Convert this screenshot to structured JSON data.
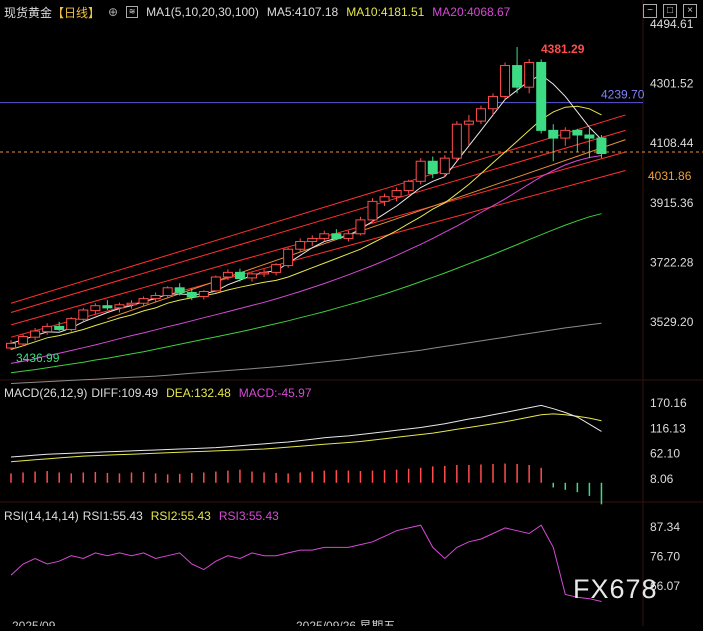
{
  "header": {
    "instrument": "现货黄金",
    "period": "【日线】",
    "ma_label": "MA1(5,10,20,30,100)",
    "ma5": "MA5:4107.18",
    "ma10": "MA10:4181.51",
    "ma20": "MA20:4068.67"
  },
  "macd_header": {
    "label": "MACD(26,12,9)",
    "diff": "DIFF:109.49",
    "dea": "DEA:132.48",
    "macd": "MACD:-45.97"
  },
  "rsi_header": {
    "label": "RSI(14,14,14)",
    "rsi1": "RSI1:55.43",
    "rsi2": "RSI2:55.43",
    "rsi3": "RSI3:55.43"
  },
  "price_axis": [
    "4494.61",
    "4301.52",
    "4108.44",
    "3915.36",
    "3722.28",
    "3529.20"
  ],
  "price_markers": {
    "high": "4381.29",
    "low": "3436.99",
    "h_line": "4239.70",
    "last": "4031.86"
  },
  "macd_axis": [
    "170.16",
    "116.13",
    "62.10",
    "8.06"
  ],
  "rsi_axis": [
    "87.34",
    "76.70",
    "66.07"
  ],
  "date_labels": [
    "2025/09",
    "2025/09/26 星期五"
  ],
  "watermark": "FX678",
  "colors": {
    "up": "#ff4d4d",
    "down": "#3ddc84",
    "ma5": "#e8e8e8",
    "ma10": "#e6e64d",
    "ma20": "#d64ad6",
    "ma30": "#3fcf3f",
    "ma100": "#8c8c8c",
    "dea": "#e6e64d",
    "rsi": "#d64ad6"
  },
  "chart_data": [
    {
      "type": "candlestick",
      "title": "现货黄金 【日线】",
      "ylim": [
        3420,
        4500
      ],
      "candles": [
        [
          3445,
          3470,
          3438,
          3460
        ],
        [
          3458,
          3490,
          3450,
          3482
        ],
        [
          3480,
          3510,
          3470,
          3500
        ],
        [
          3498,
          3525,
          3488,
          3515
        ],
        [
          3515,
          3530,
          3500,
          3505
        ],
        [
          3505,
          3545,
          3498,
          3540
        ],
        [
          3538,
          3575,
          3530,
          3568
        ],
        [
          3566,
          3590,
          3555,
          3582
        ],
        [
          3582,
          3600,
          3568,
          3575
        ],
        [
          3575,
          3592,
          3560,
          3585
        ],
        [
          3585,
          3600,
          3572,
          3590
        ],
        [
          3590,
          3612,
          3580,
          3605
        ],
        [
          3605,
          3625,
          3595,
          3615
        ],
        [
          3615,
          3645,
          3605,
          3640
        ],
        [
          3640,
          3655,
          3615,
          3625
        ],
        [
          3625,
          3638,
          3600,
          3610
        ],
        [
          3612,
          3632,
          3602,
          3628
        ],
        [
          3630,
          3680,
          3625,
          3675
        ],
        [
          3675,
          3700,
          3665,
          3690
        ],
        [
          3690,
          3702,
          3660,
          3670
        ],
        [
          3672,
          3690,
          3660,
          3685
        ],
        [
          3685,
          3700,
          3675,
          3690
        ],
        [
          3690,
          3720,
          3680,
          3715
        ],
        [
          3712,
          3770,
          3705,
          3765
        ],
        [
          3765,
          3800,
          3755,
          3790
        ],
        [
          3790,
          3810,
          3775,
          3800
        ],
        [
          3800,
          3825,
          3790,
          3815
        ],
        [
          3815,
          3830,
          3795,
          3800
        ],
        [
          3800,
          3825,
          3790,
          3815
        ],
        [
          3815,
          3870,
          3810,
          3860
        ],
        [
          3860,
          3930,
          3850,
          3920
        ],
        [
          3920,
          3945,
          3905,
          3935
        ],
        [
          3935,
          3965,
          3920,
          3955
        ],
        [
          3955,
          3990,
          3945,
          3985
        ],
        [
          3985,
          4060,
          3975,
          4050
        ],
        [
          4050,
          4065,
          3995,
          4010
        ],
        [
          4010,
          4070,
          4000,
          4060
        ],
        [
          4060,
          4180,
          4050,
          4170
        ],
        [
          4170,
          4200,
          4100,
          4180
        ],
        [
          4180,
          4230,
          4170,
          4220
        ],
        [
          4220,
          4270,
          4200,
          4260
        ],
        [
          4260,
          4370,
          4250,
          4360
        ],
        [
          4360,
          4420,
          4270,
          4290
        ],
        [
          4290,
          4381.29,
          4270,
          4370
        ],
        [
          4370,
          4380,
          4140,
          4150
        ],
        [
          4150,
          4170,
          4050,
          4125
        ],
        [
          4125,
          4160,
          4100,
          4150
        ],
        [
          4150,
          4155,
          4080,
          4135
        ],
        [
          4135,
          4160,
          4060,
          4125
        ],
        [
          4125,
          4135,
          4060,
          4075
        ]
      ],
      "ma5": [
        3460,
        3472,
        3485,
        3497,
        3496,
        3510,
        3530,
        3545,
        3560,
        3573,
        3582,
        3595,
        3605,
        3620,
        3620,
        3618,
        3620,
        3630,
        3650,
        3665,
        3680,
        3690,
        3695,
        3720,
        3745,
        3770,
        3790,
        3800,
        3810,
        3830,
        3855,
        3880,
        3905,
        3935,
        3965,
        3985,
        4000,
        4050,
        4100,
        4150,
        4200,
        4250,
        4280,
        4310,
        4330,
        4300,
        4260,
        4210,
        4160,
        4120
      ],
      "ma10": [
        3440,
        3452,
        3465,
        3478,
        3485,
        3495,
        3505,
        3518,
        3530,
        3542,
        3552,
        3565,
        3575,
        3590,
        3600,
        3608,
        3614,
        3622,
        3633,
        3642,
        3650,
        3658,
        3664,
        3675,
        3690,
        3705,
        3720,
        3735,
        3750,
        3765,
        3785,
        3805,
        3825,
        3848,
        3870,
        3895,
        3915,
        3945,
        3975,
        4010,
        4045,
        4080,
        4115,
        4150,
        4185,
        4210,
        4225,
        4228,
        4220,
        4200
      ],
      "ma20": [
        3395,
        3402,
        3410,
        3420,
        3428,
        3437,
        3446,
        3455,
        3465,
        3475,
        3485,
        3494,
        3504,
        3514,
        3523,
        3533,
        3543,
        3553,
        3563,
        3573,
        3583,
        3593,
        3604,
        3616,
        3628,
        3641,
        3654,
        3668,
        3682,
        3697,
        3712,
        3728,
        3745,
        3763,
        3781,
        3800,
        3820,
        3840,
        3862,
        3884,
        3906,
        3928,
        3952,
        3976,
        4000,
        4020,
        4038,
        4052,
        4062,
        4068.67
      ],
      "ma30": [
        3365,
        3370,
        3375,
        3381,
        3387,
        3393,
        3399,
        3406,
        3412,
        3419,
        3426,
        3433,
        3441,
        3449,
        3457,
        3465,
        3473,
        3481,
        3489,
        3497,
        3506,
        3515,
        3524,
        3533,
        3543,
        3553,
        3563,
        3574,
        3585,
        3596,
        3608,
        3620,
        3633,
        3646,
        3660,
        3674,
        3688,
        3703,
        3718,
        3733,
        3748,
        3764,
        3780,
        3796,
        3812,
        3828,
        3843,
        3857,
        3870,
        3880
      ],
      "ma100": [
        3330,
        3332,
        3334,
        3336,
        3338,
        3340,
        3342,
        3344,
        3346,
        3348,
        3350,
        3352,
        3354,
        3357,
        3360,
        3363,
        3366,
        3369,
        3372,
        3375,
        3378,
        3381,
        3384,
        3388,
        3392,
        3396,
        3400,
        3404,
        3408,
        3413,
        3418,
        3423,
        3428,
        3433,
        3438,
        3444,
        3450,
        3456,
        3462,
        3468,
        3474,
        3480,
        3486,
        3492,
        3498,
        3504,
        3510,
        3515,
        3520,
        3525
      ],
      "trendlines": [
        {
          "color": "#ff3030",
          "from": [
            0,
            3590
          ],
          "to": [
            50,
            4200
          ]
        },
        {
          "color": "#ff3030",
          "from": [
            0,
            3560
          ],
          "to": [
            50,
            4150
          ]
        },
        {
          "color": "#ff3030",
          "from": [
            0,
            3520
          ],
          "to": [
            50,
            4080
          ]
        },
        {
          "color": "#ff3030",
          "from": [
            0,
            3480
          ],
          "to": [
            50,
            4020
          ]
        },
        {
          "color": "#e69038",
          "from": [
            8,
            3540
          ],
          "to": [
            50,
            4120
          ]
        }
      ]
    },
    {
      "type": "bar",
      "title": "MACD(26,12,9)",
      "ylim": [
        -10,
        185
      ],
      "diff": [
        55,
        57,
        59,
        61,
        62,
        63,
        64,
        65,
        66,
        67,
        68,
        69,
        70,
        71,
        72,
        73,
        74,
        75,
        77,
        79,
        81,
        83,
        85,
        87,
        90,
        93,
        96,
        98,
        100,
        103,
        106,
        109,
        112,
        115,
        118,
        122,
        126,
        131,
        136,
        140,
        145,
        150,
        155,
        160,
        165,
        158,
        150,
        140,
        125,
        109.49
      ],
      "dea": [
        45,
        47,
        49,
        51,
        53,
        55,
        57,
        58,
        59,
        60,
        61,
        62,
        63,
        64,
        65,
        66,
        67,
        68,
        69,
        70,
        71,
        72,
        74,
        76,
        78,
        80,
        82,
        84,
        86,
        88,
        91,
        94,
        97,
        100,
        103,
        106,
        110,
        114,
        118,
        122,
        126,
        130,
        135,
        140,
        145,
        147,
        145,
        142,
        138,
        132.48
      ],
      "macd": [
        20,
        22,
        24,
        25,
        22,
        20,
        22,
        23,
        21,
        20,
        22,
        23,
        20,
        18,
        19,
        21,
        22,
        24,
        26,
        28,
        24,
        22,
        21,
        20,
        22,
        24,
        26,
        27,
        26,
        25,
        26,
        27,
        28,
        30,
        32,
        35,
        36,
        38,
        38,
        39,
        40,
        41,
        40,
        38,
        32,
        -10,
        -15,
        -20,
        -28,
        -45.97
      ]
    },
    {
      "type": "line",
      "title": "RSI(14,14,14)",
      "ylim": [
        60,
        92
      ],
      "values": [
        70,
        74,
        76,
        74,
        75,
        77,
        76,
        78,
        77,
        78,
        77,
        78,
        76,
        77,
        78,
        74,
        72,
        75,
        77,
        76,
        78,
        77,
        77,
        78,
        79,
        79,
        80,
        80,
        80,
        81,
        82,
        84,
        86,
        87,
        88,
        80,
        76,
        80,
        82,
        83,
        85,
        87,
        86,
        85,
        88,
        80,
        63,
        62,
        61.5,
        60.5
      ]
    }
  ]
}
